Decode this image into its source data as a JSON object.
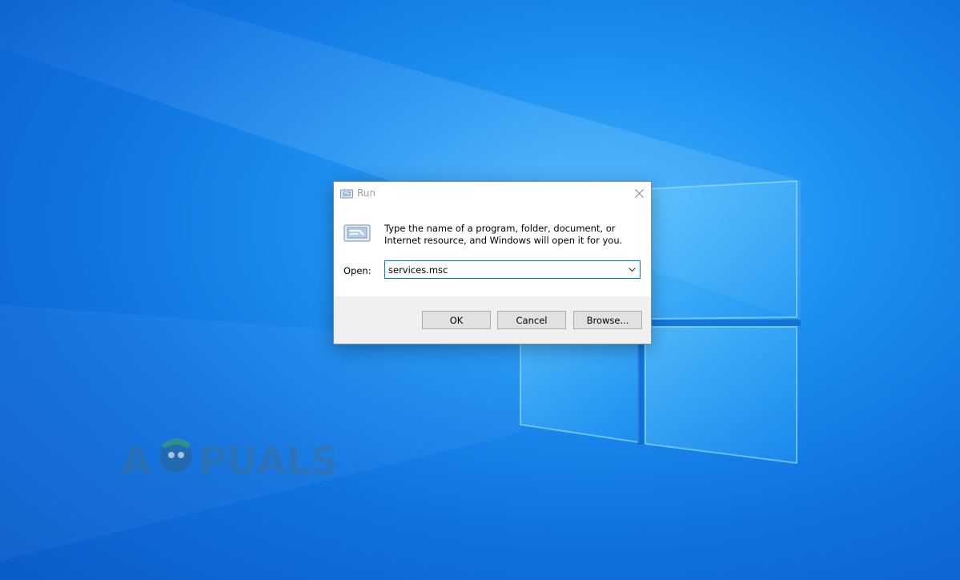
{
  "desktop": {
    "background_color": "#1a87ea",
    "watermark_text": "APPUALS"
  },
  "run_dialog": {
    "title": "Run",
    "close_icon": "close-icon",
    "app_icon": "run-icon",
    "description": "Type the name of a program, folder, document, or Internet resource, and Windows will open it for you.",
    "open_label": "Open:",
    "open_value": "services.msc",
    "dropdown_icon": "chevron-down-icon",
    "buttons": {
      "ok": "OK",
      "cancel": "Cancel",
      "browse": "Browse..."
    },
    "accent_color": "#0078d7"
  }
}
